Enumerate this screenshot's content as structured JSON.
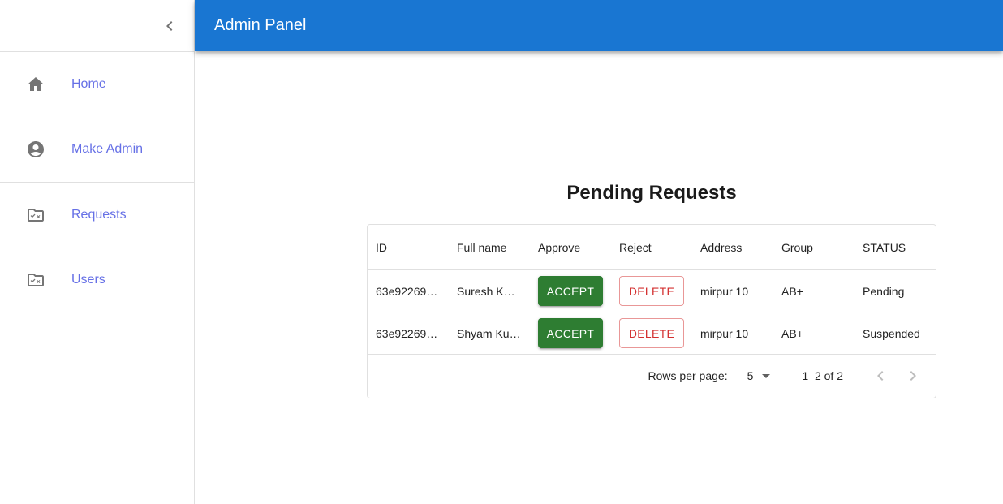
{
  "app": {
    "title": "Admin Panel"
  },
  "sidebar": {
    "items": [
      {
        "label": "Home",
        "icon": "home-icon"
      },
      {
        "label": "Make Admin",
        "icon": "account-circle-icon"
      },
      {
        "label": "Requests",
        "icon": "rule-folder-icon"
      },
      {
        "label": "Users",
        "icon": "rule-folder-icon"
      }
    ]
  },
  "main": {
    "title": "Pending Requests"
  },
  "table": {
    "columns": [
      "ID",
      "Full name",
      "Approve",
      "Reject",
      "Address",
      "Group",
      "STATUS"
    ],
    "rows": [
      {
        "id": "63e92269…",
        "name": "Suresh K…",
        "approve": "ACCEPT",
        "reject": "DELETE",
        "address": "mirpur 10",
        "group": "AB+",
        "status": "Pending"
      },
      {
        "id": "63e92269…",
        "name": "Shyam Ku…",
        "approve": "ACCEPT",
        "reject": "DELETE",
        "address": "mirpur 10",
        "group": "AB+",
        "status": "Suspended"
      }
    ],
    "footer": {
      "rows_per_page_label": "Rows per page:",
      "rows_per_page": "5",
      "range": "1–2 of 2"
    }
  },
  "colors": {
    "appbar": "#1976d2",
    "accept": "#2e7d32",
    "delete": "#d32f2f",
    "nav_text": "#6670e6"
  }
}
